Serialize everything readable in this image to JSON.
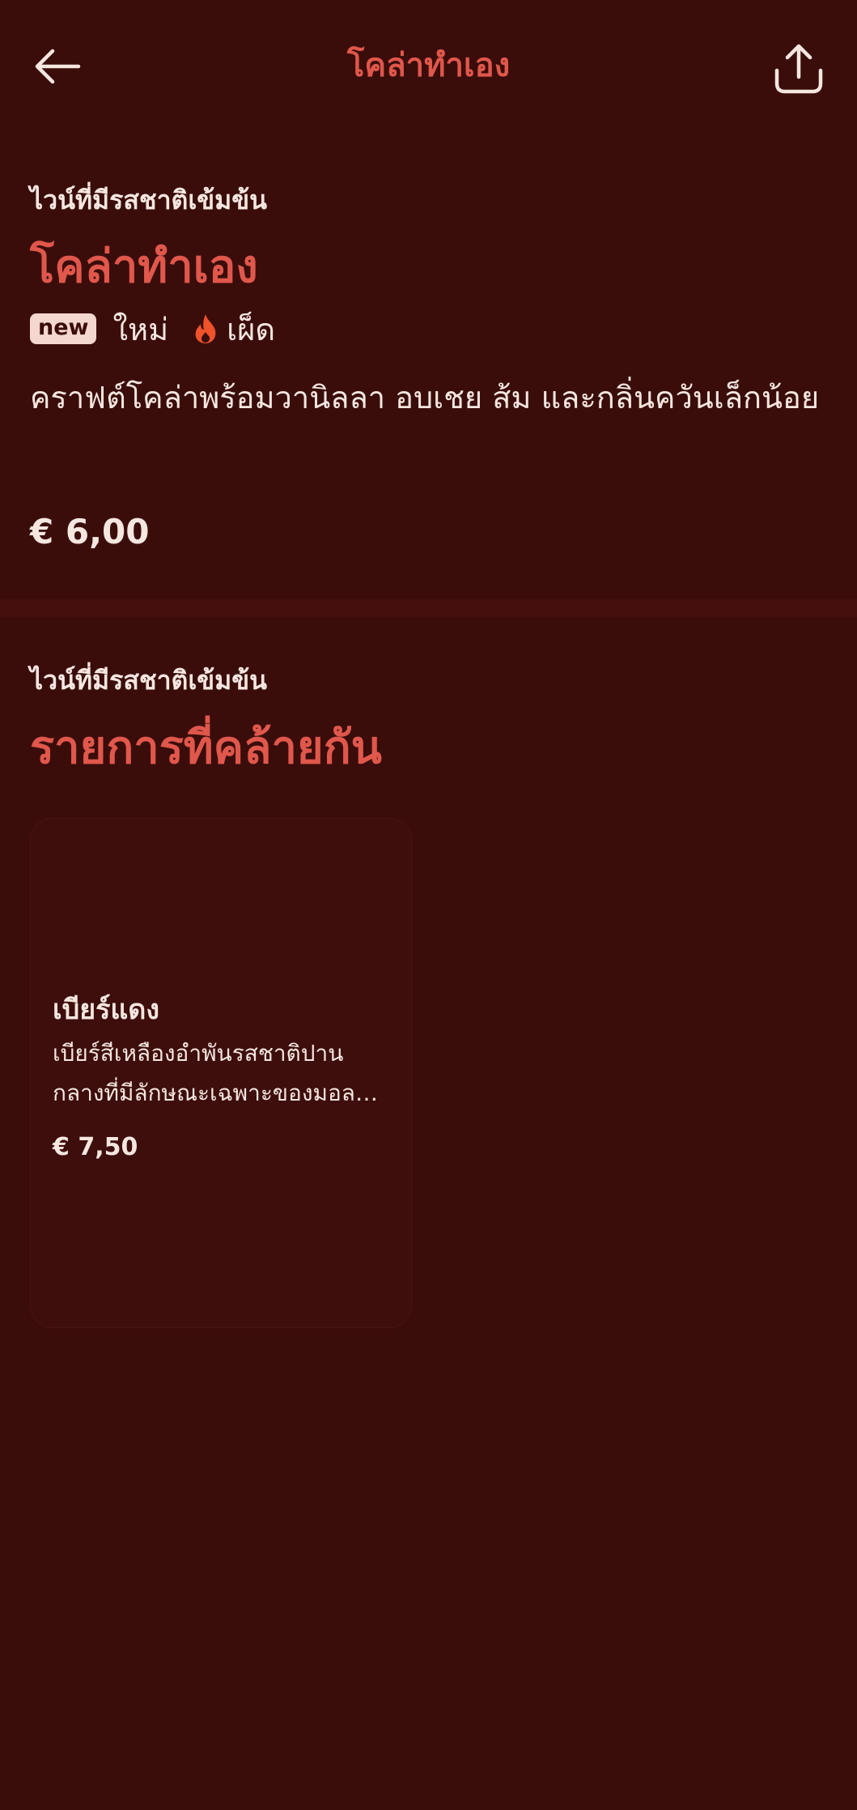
{
  "header": {
    "title": "โคล่าทำเอง",
    "back_icon": "arrow-left-icon",
    "share_icon": "share-icon"
  },
  "product": {
    "category": "ไวน์ที่มีรสชาติเข้มข้น",
    "name": "โคล่าทำเอง",
    "badge": "new",
    "new_label": "ใหม่",
    "spicy_icon": "flame-icon",
    "spicy_label": "เผ็ด",
    "description": "คราฟต์โคล่าพร้อมวานิลลา อบเชย ส้ม และกลิ่นควันเล็กน้อย",
    "price": "€ 6,00"
  },
  "similar": {
    "category": "ไวน์ที่มีรสชาติเข้มข้น",
    "heading": "รายการที่คล้ายกัน",
    "items": [
      {
        "name": "เบียร์แดง",
        "description": "เบียร์สีเหลืองอำพันรสชาติปานกลางที่มีลักษณะเฉพาะของมอลต์คาราเมล",
        "price": "€ 7,50"
      }
    ]
  },
  "colors": {
    "background": "#3a0d0b",
    "accent": "#e0574b",
    "text": "#f6e6e0",
    "flame": "#f0522a"
  }
}
